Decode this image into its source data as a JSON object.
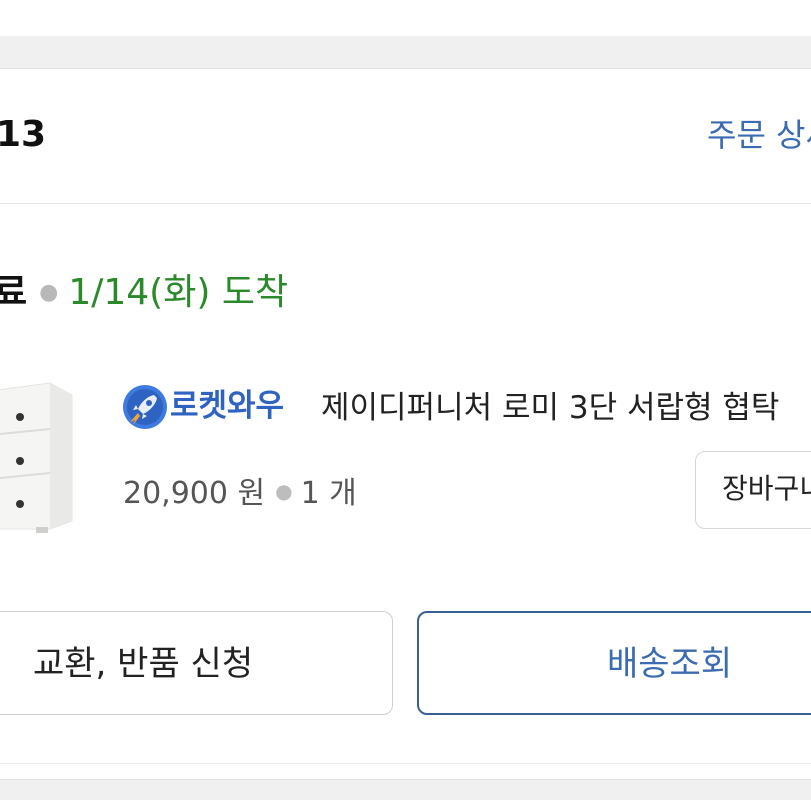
{
  "order": {
    "date_fragment": "13",
    "detail_link": "주문 상세보기"
  },
  "shipment": {
    "status": "배송완료",
    "status_visible": "료",
    "arrival": "1/14(화) 도착"
  },
  "product": {
    "badge_label": "로켓와우",
    "badge_icon": "rocket-icon",
    "title": "제이디퍼니처 로미 3단 서랍형 협탁",
    "price": "20,900 원",
    "quantity": "1 개",
    "image": "white-3-drawer-cabinet"
  },
  "buttons": {
    "add_to_cart": "장바구니 담기",
    "add_to_cart_visible": "장바구니",
    "return_request": "교환, 반품 신청",
    "track_delivery": "배송조회"
  },
  "colors": {
    "accent_blue": "#3b6bb0",
    "arrival_green": "#2a8a2a",
    "badge_blue": "#2f63c2"
  }
}
